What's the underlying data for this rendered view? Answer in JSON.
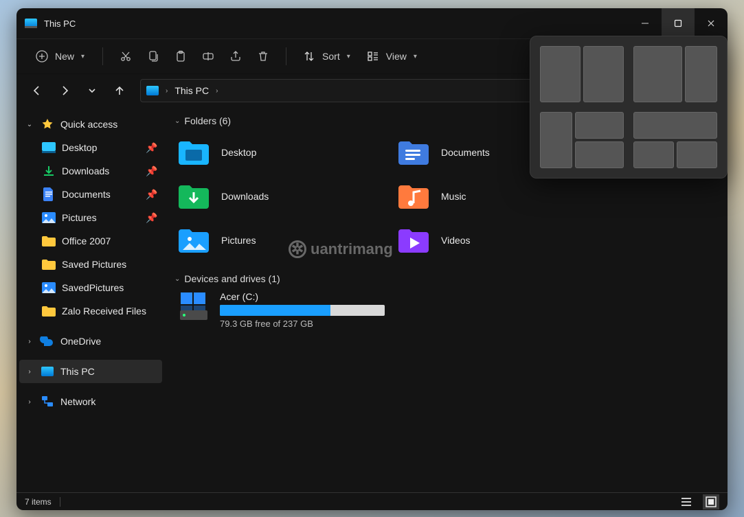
{
  "window": {
    "title": "This PC"
  },
  "toolbar": {
    "new": "New",
    "sort": "Sort",
    "view": "View"
  },
  "address": {
    "path": "This PC"
  },
  "sidebar": {
    "quick_access": "Quick access",
    "items": [
      {
        "label": "Desktop",
        "pinned": true
      },
      {
        "label": "Downloads",
        "pinned": true
      },
      {
        "label": "Documents",
        "pinned": true
      },
      {
        "label": "Pictures",
        "pinned": true
      },
      {
        "label": "Office 2007",
        "pinned": false
      },
      {
        "label": "Saved Pictures",
        "pinned": false
      },
      {
        "label": "SavedPictures",
        "pinned": false
      },
      {
        "label": "Zalo Received Files",
        "pinned": false
      }
    ],
    "onedrive": "OneDrive",
    "this_pc": "This PC",
    "network": "Network"
  },
  "sections": {
    "folders_header": "Folders (6)",
    "drives_header": "Devices and drives (1)"
  },
  "folders": [
    {
      "label": "Desktop"
    },
    {
      "label": "Documents"
    },
    {
      "label": "Downloads"
    },
    {
      "label": "Music"
    },
    {
      "label": "Pictures"
    },
    {
      "label": "Videos"
    }
  ],
  "drive": {
    "label": "Acer (C:)",
    "free_text": "79.3 GB free of 237 GB",
    "fill_percent": 67
  },
  "status": {
    "text": "7 items"
  },
  "watermark": {
    "text": "uantrimang"
  }
}
